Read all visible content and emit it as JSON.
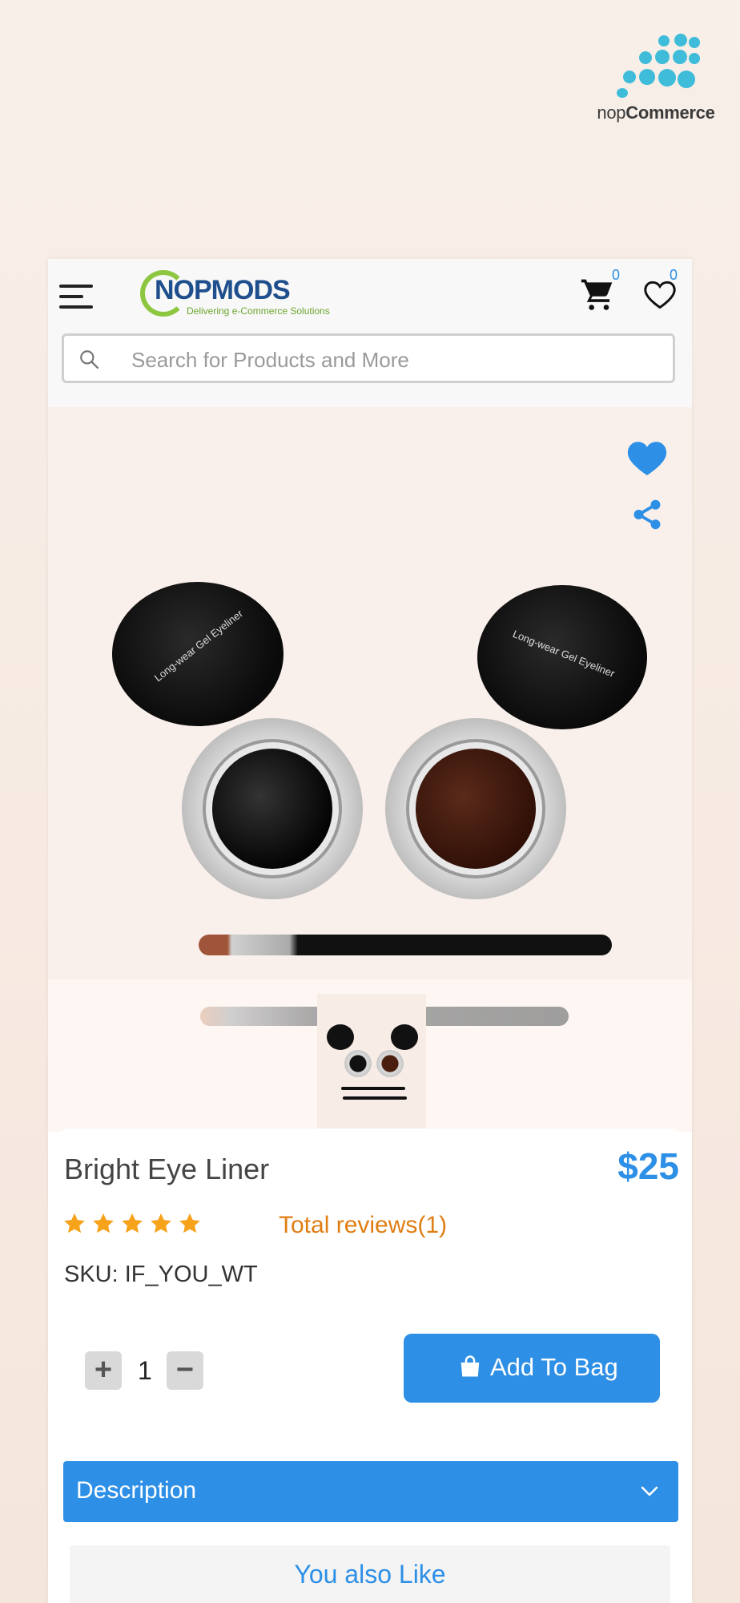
{
  "platform_logo": {
    "word_light": "nop",
    "word_bold": "Commerce"
  },
  "header": {
    "brand_name": "NOPMODS",
    "brand_tagline": "Delivering e-Commerce Solutions",
    "cart_count": "0",
    "wishlist_count": "0",
    "search_placeholder": "Search for Products and More"
  },
  "hero": {
    "lid_text": "Long-wear Gel Eyeliner"
  },
  "product": {
    "name": "Bright Eye Liner",
    "price": "$25",
    "rating": 5,
    "rating_max": 5,
    "reviews_label": "Total reviews(1)",
    "sku": "SKU: IF_YOU_WT",
    "quantity": "1",
    "add_to_bag_label": "Add To Bag"
  },
  "sections": {
    "description_label": "Description",
    "you_also_like_label": "You also Like"
  },
  "colors": {
    "accent": "#2d8fe6",
    "rating_star": "#f7a21b",
    "reviews_text": "#e07e14",
    "brand_green": "#8dc63f",
    "brand_blue": "#1f4e8c"
  }
}
